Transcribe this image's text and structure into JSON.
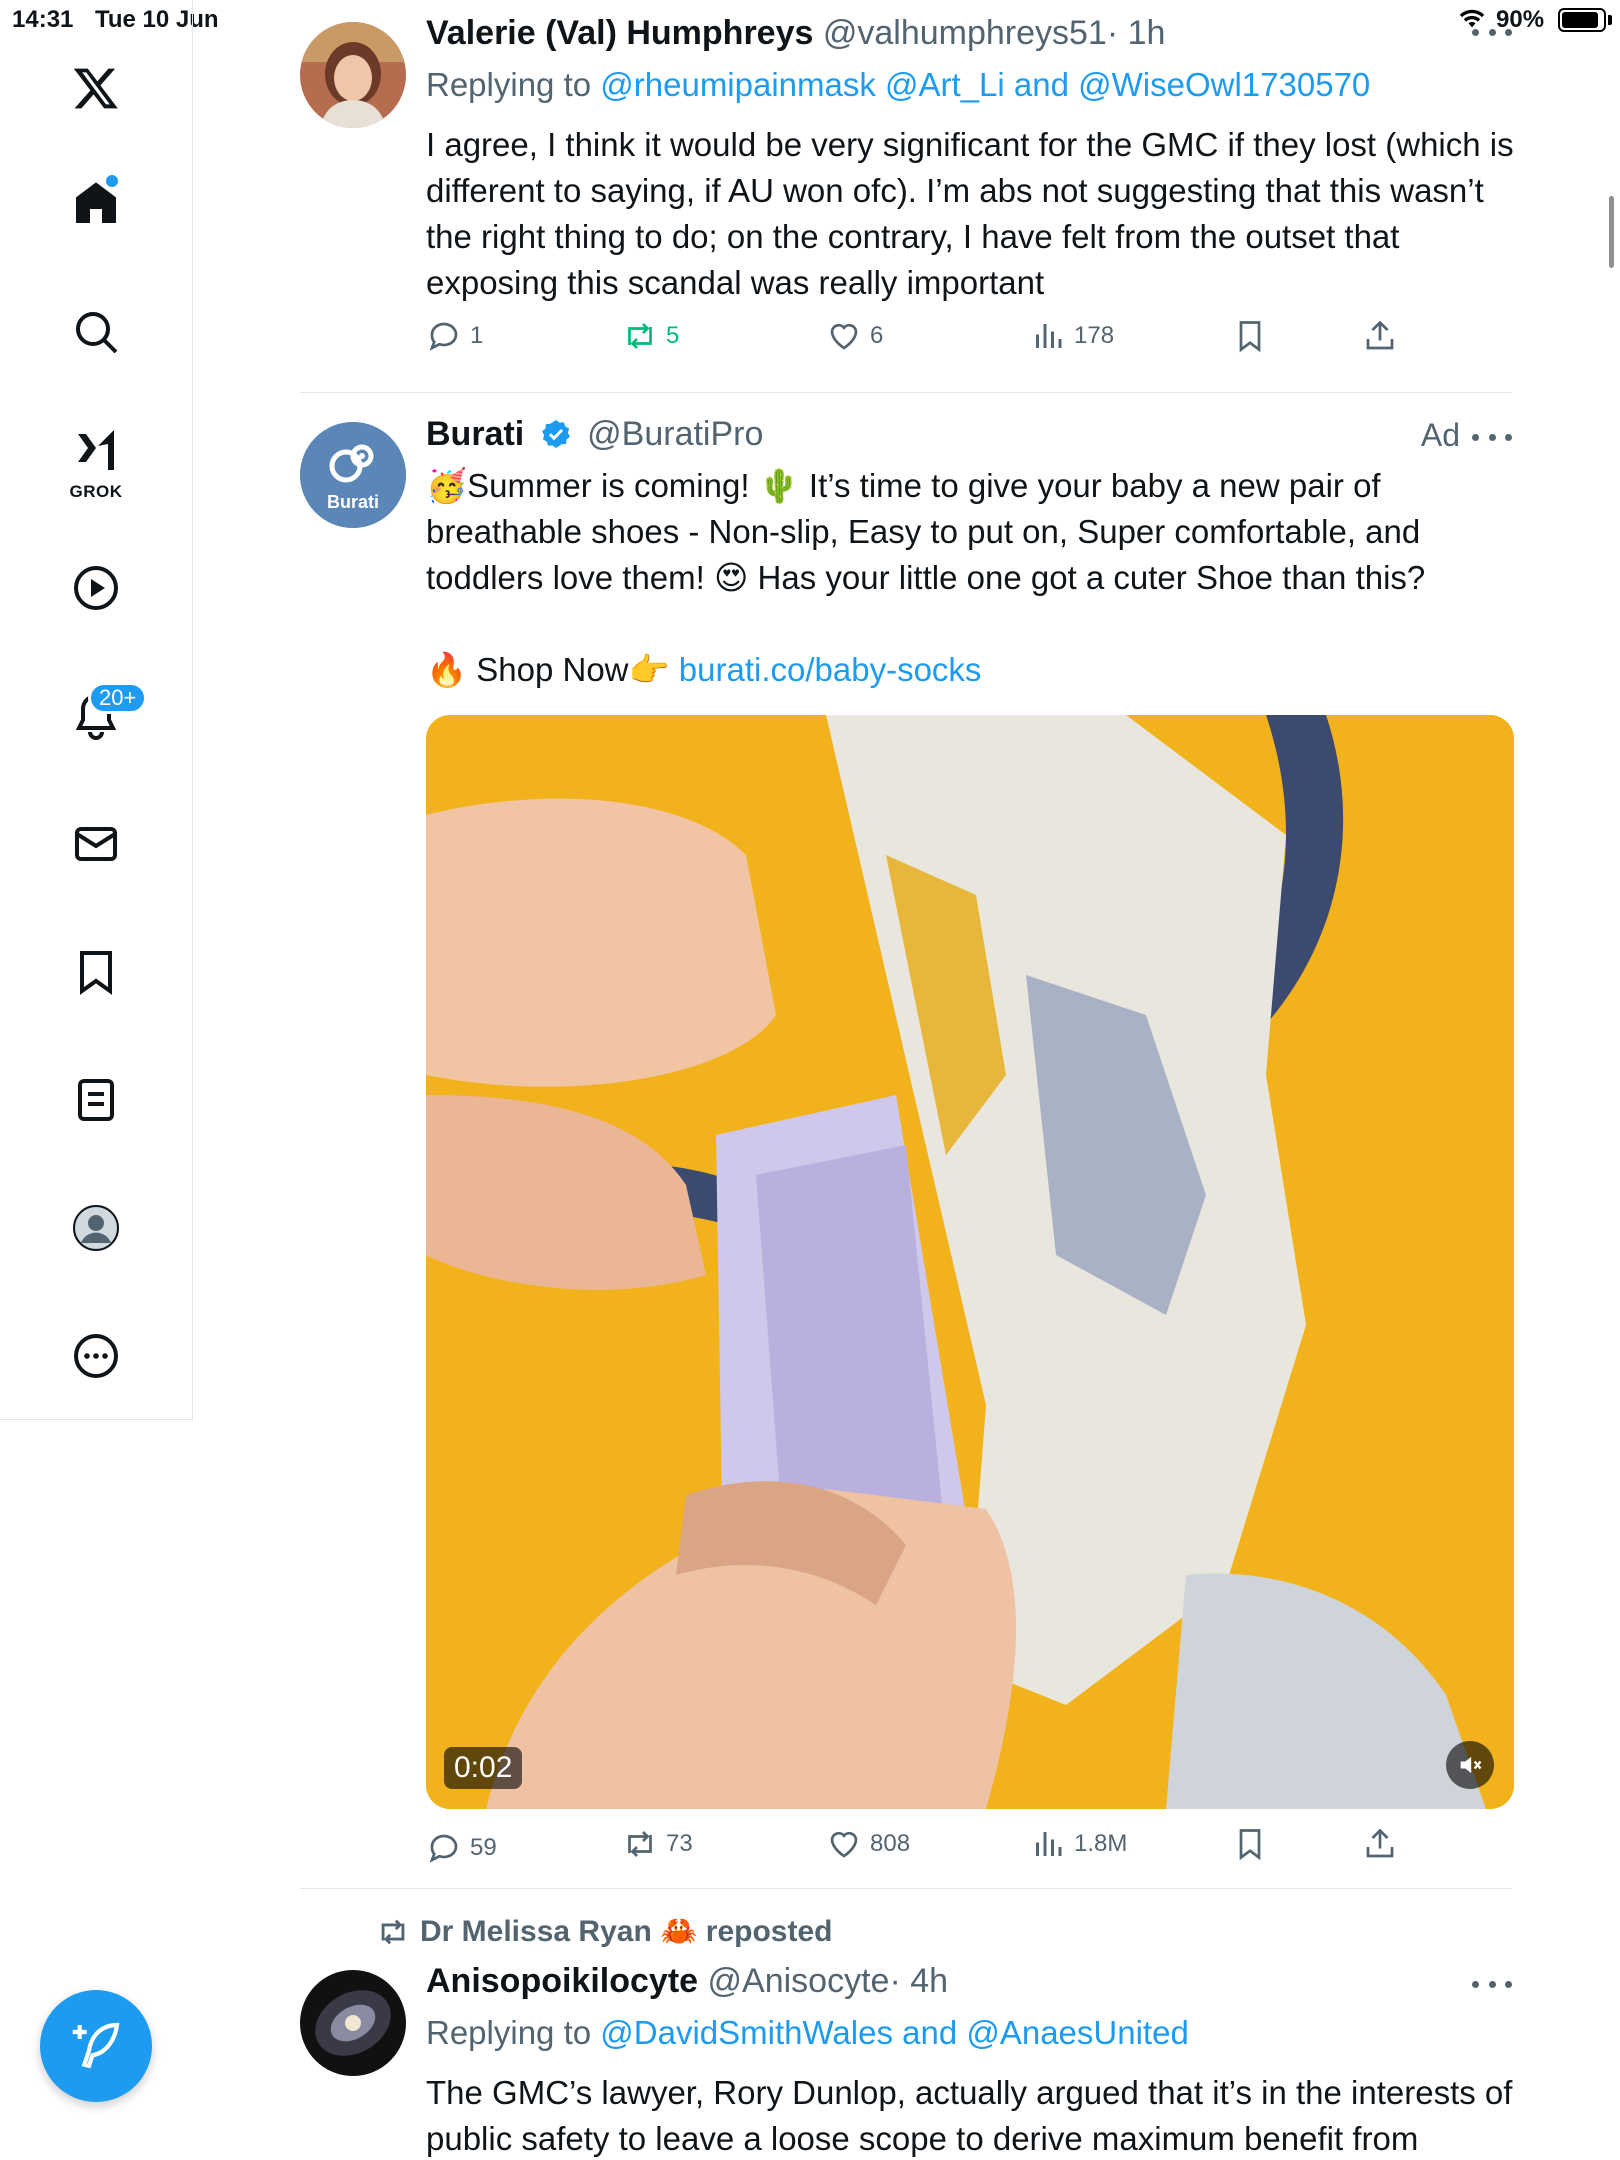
{
  "status_bar": {
    "time": "14:31",
    "date": "Tue 10 Jun",
    "battery": "90%"
  },
  "nav": {
    "items": [
      "home",
      "explore",
      "grok",
      "videos",
      "notifications",
      "messages",
      "bookmarks",
      "lists",
      "profile",
      "more"
    ],
    "grok_label": "GROK",
    "notifications_badge": "20+"
  },
  "tweets": [
    {
      "name": "Valerie (Val) Humphreys",
      "handle": "@valhumphreys51",
      "time": "· 1h",
      "replying_prefix": "Replying to ",
      "replying_to": "@rheumipainmask @Art_Li and @WiseOwl1730570",
      "text": "I agree, I think it would be very significant for the GMC if they lost (which is different to saying, if AU won ofc). I’m abs not suggesting that this wasn’t the right thing to do; on the contrary, I have felt from the outset that exposing this scandal was really important",
      "replies": "1",
      "reposts": "5",
      "likes": "6",
      "views": "178"
    },
    {
      "name": "Burati",
      "handle": "@BuratiPro",
      "ad_label": "Ad",
      "avatar_text": "Burati",
      "text_p1": "🥳Summer is coming! 🌵 It’s time to give your baby a new pair of breathable shoes - Non-slip, Easy to put on, Super comfortable, and toddlers love them! 😍 Has your little one got a cuter Shoe than this?",
      "text_p2": "🔥 Shop Now👉 ",
      "link": "burati.co/baby-socks",
      "video_time": "0:02",
      "replies": "59",
      "reposts": "73",
      "likes": "808",
      "views": "1.8M"
    },
    {
      "reposted_by": "Dr Melissa Ryan 🦀 reposted",
      "name": "Anisopoikilocyte",
      "handle": "@Anisocyte",
      "time": "· 4h",
      "replying_prefix": "Replying to ",
      "replying_to": "@DavidSmithWales and @AnaesUnited",
      "text": "The GMC’s lawyer, Rory Dunlop, actually argued that it’s in the interests of public safety to leave a loose scope to derive maximum benefit from"
    }
  ],
  "colors": {
    "accent": "#1d9bf0",
    "repost_green": "#00ba7c",
    "muted": "#536471",
    "media_bg": "#f3b41e"
  }
}
